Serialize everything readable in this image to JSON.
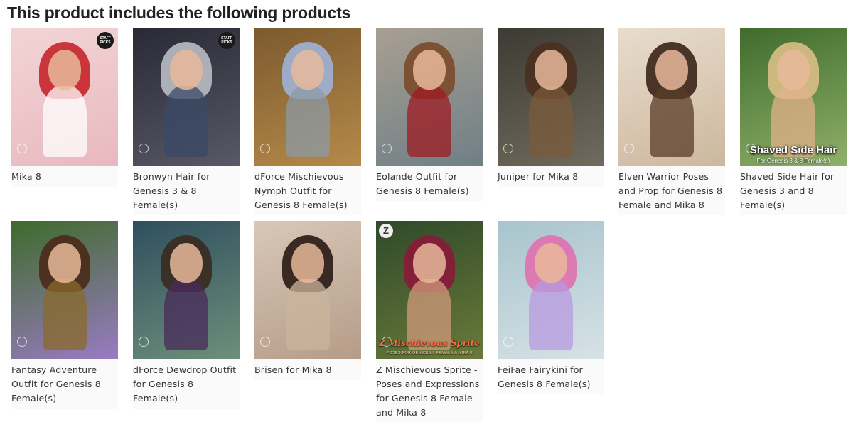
{
  "heading": "This product includes the following products",
  "products": [
    {
      "title": "Mika 8",
      "badge": "STAFF PICKS",
      "colors": {
        "bg1": "#f3d4d6",
        "bg2": "#e7b9bf",
        "hair": "#c4252b",
        "body": "#ffffff"
      }
    },
    {
      "title": "Bronwyn Hair for Genesis 3 & 8 Female(s)",
      "badge": "STAFF PICKS",
      "colors": {
        "bg1": "#2a2a36",
        "bg2": "#585866",
        "hair": "#b9bcc3",
        "body": "#3a4a66"
      }
    },
    {
      "title": "dForce Mischievous Nymph Outfit for Genesis 8 Female(s)",
      "colors": {
        "bg1": "#7d5a2e",
        "bg2": "#b58a4a",
        "hair": "#9fb3d6",
        "body": "#8c9aa6"
      }
    },
    {
      "title": "Eolande Outfit for Genesis 8 Female(s)",
      "colors": {
        "bg1": "#a89f92",
        "bg2": "#6f7f86",
        "hair": "#7a4a2a",
        "body": "#9e1b22"
      }
    },
    {
      "title": "Juniper for Mika 8",
      "colors": {
        "bg1": "#3d3a33",
        "bg2": "#6f6b5d",
        "hair": "#4a3020",
        "body": "#7b5a3a"
      }
    },
    {
      "title": "Elven Warrior Poses and Prop for Genesis 8 Female and Mika 8",
      "colors": {
        "bg1": "#e8dccd",
        "bg2": "#cdb79e",
        "hair": "#3a2418",
        "body": "#5a3c28"
      }
    },
    {
      "title": "Shaved Side Hair for Genesis 3 and 8 Female(s)",
      "overlay_title": "Shaved Side Hair",
      "overlay_sub": "For Genesis 3 & 8 Female(s)",
      "colors": {
        "bg1": "#3f6b2c",
        "bg2": "#8fb06a",
        "hair": "#d9bf86",
        "body": "#e1b08c"
      }
    },
    {
      "title": "Fantasy Adventure Outfit for Genesis 8 Female(s)",
      "colors": {
        "bg1": "#3e6b2a",
        "bg2": "#9a7bc4",
        "hair": "#4a2a18",
        "body": "#8a6a2a"
      }
    },
    {
      "title": "dForce Dewdrop Outfit for Genesis 8 Female(s)",
      "colors": {
        "bg1": "#2f4f5f",
        "bg2": "#6d8f7a",
        "hair": "#3a2a20",
        "body": "#4a2a5a"
      }
    },
    {
      "title": "Brisen for Mika 8",
      "colors": {
        "bg1": "#d8c7b8",
        "bg2": "#b59c88",
        "hair": "#2a1a14",
        "body": "#c9b49c"
      }
    },
    {
      "title": "Z Mischievous Sprite - Poses and Expressions for Genesis 8 Female and Mika 8",
      "overlay_title": "Z Mischievous Sprite",
      "overlay_sub": "POSES FOR GENESIS 8 FEMALE & MIKA 8",
      "z_logo": "Z",
      "colors": {
        "bg1": "#2f4a2a",
        "bg2": "#6a7a3a",
        "hair": "#8a1a3a",
        "body": "#d09a7a"
      }
    },
    {
      "title": "FeiFae Fairykini for Genesis 8 Female(s)",
      "colors": {
        "bg1": "#a8c4cc",
        "bg2": "#d6e2e6",
        "hair": "#e070b0",
        "body": "#b89ae0"
      }
    }
  ]
}
